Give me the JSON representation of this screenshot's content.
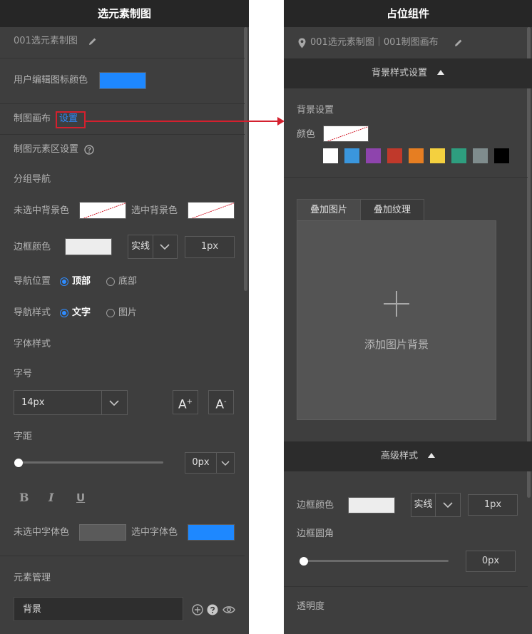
{
  "left_panel": {
    "title": "选元素制图",
    "element_name": "001选元素制图",
    "user_icon_color_label": "用户编辑图标颜色",
    "user_icon_color": "#1e88ff",
    "canvas_label": "制图画布",
    "canvas_link": "设置",
    "element_area_label": "制图元素区设置",
    "group_nav_label": "分组导航",
    "unselected_bg_label": "未选中背景色",
    "selected_bg_label": "选中背景色",
    "border_color_label": "边框颜色",
    "border_style": "实线",
    "border_width": "1px",
    "nav_position_label": "导航位置",
    "nav_position_options": [
      "顶部",
      "底部"
    ],
    "nav_style_label": "导航样式",
    "nav_style_options": [
      "文字",
      "图片"
    ],
    "font_style_label": "字体样式",
    "font_size_label": "字号",
    "font_size": "14px",
    "letter_spacing_label": "字距",
    "letter_spacing": "0px",
    "letter_spacing_level": 0,
    "format_buttons": [
      "B",
      "I",
      "U"
    ],
    "unselected_font_color_label": "未选中字体色",
    "unselected_font_color": "#5a5a5a",
    "selected_font_color_label": "选中字体色",
    "selected_font_color": "#1e88ff",
    "element_mgmt_label": "元素管理",
    "element_item": "背景"
  },
  "right_panel": {
    "title": "占位组件",
    "breadcrumb": "001选元素制图｜001制图画布",
    "bg_style_section": "背景样式设置",
    "bg_settings_label": "背景设置",
    "color_label": "颜色",
    "color_presets": [
      "#ffffff",
      "#3a96dd",
      "#8e44ad",
      "#c0392b",
      "#e67e22",
      "#f4d03f",
      "#2e9e7f",
      "#7f8c8d",
      "#000000"
    ],
    "tabs": [
      "叠加图片",
      "叠加纹理"
    ],
    "add_image_text": "添加图片背景",
    "advanced_section": "高级样式",
    "border_color_label": "边框颜色",
    "border_style": "实线",
    "border_width": "1px",
    "border_radius_label": "边框圆角",
    "border_radius": "0px",
    "border_radius_level": 0,
    "opacity_label": "透明度"
  },
  "annotation_color": "#d4202e"
}
